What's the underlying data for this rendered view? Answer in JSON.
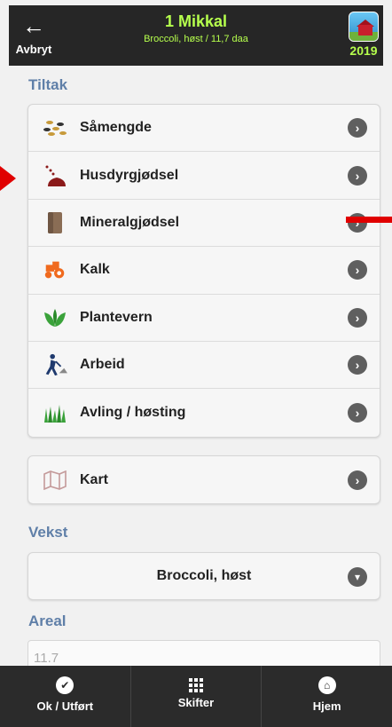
{
  "header": {
    "back_label": "Avbryt",
    "title": "1 Mikkal",
    "subtitle": "Broccoli, høst / 11,7 daa",
    "year": "2019"
  },
  "tiltak": {
    "title": "Tiltak",
    "items": [
      {
        "label": "Såmengde",
        "icon": "seed-icon"
      },
      {
        "label": "Husdyrgjødsel",
        "icon": "manure-icon"
      },
      {
        "label": "Mineralgjødsel",
        "icon": "fertilizer-bag-icon"
      },
      {
        "label": "Kalk",
        "icon": "tractor-icon"
      },
      {
        "label": "Plantevern",
        "icon": "plant-icon"
      },
      {
        "label": "Arbeid",
        "icon": "worker-icon"
      },
      {
        "label": "Avling / høsting",
        "icon": "grass-icon"
      }
    ]
  },
  "map": {
    "label": "Kart",
    "icon": "map-icon"
  },
  "vekst": {
    "title": "Vekst",
    "value": "Broccoli, høst"
  },
  "areal": {
    "title": "Areal",
    "value": "11.7"
  },
  "footer": {
    "ok_label": "Ok / Utført",
    "skifter_label": "Skifter",
    "hjem_label": "Hjem"
  },
  "colors": {
    "accent_green": "#b6ff4d",
    "section_blue": "#5f7fa8",
    "header_bg": "#262626",
    "annotation_red": "#e00000"
  }
}
